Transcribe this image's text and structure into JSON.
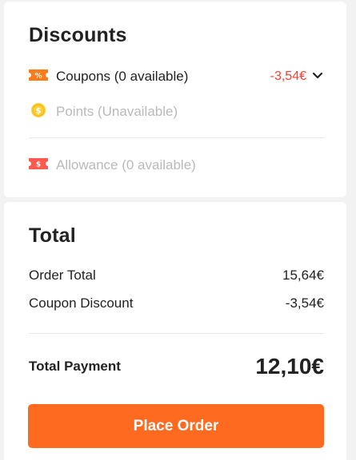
{
  "discounts": {
    "title": "Discounts",
    "coupons": {
      "label": "Coupons (0 available)",
      "value": "-3,54€",
      "icon": "coupon-tag-icon"
    },
    "points": {
      "label": "Points (Unavailable)",
      "icon": "coin-icon"
    },
    "allowance": {
      "label": "Allowance (0 available)",
      "icon": "allowance-tag-icon"
    }
  },
  "total": {
    "title": "Total",
    "order_total_label": "Order Total",
    "order_total_value": "15,64€",
    "coupon_discount_label": "Coupon Discount",
    "coupon_discount_value": "-3,54€",
    "payment_label": "Total Payment",
    "payment_value": "12,10€"
  },
  "place_order_label": "Place Order",
  "colors": {
    "accent": "#ff6a21",
    "discount_red": "#ff3b30",
    "muted": "#b9b9b9"
  }
}
